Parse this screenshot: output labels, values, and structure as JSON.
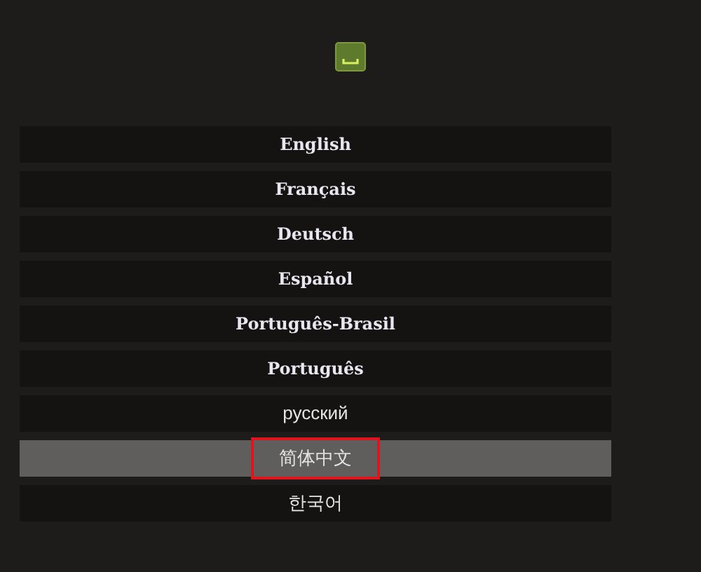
{
  "languages": [
    {
      "label": "English",
      "kind": "bold",
      "selected": false,
      "annotated": false
    },
    {
      "label": "Français",
      "kind": "bold",
      "selected": false,
      "annotated": false
    },
    {
      "label": "Deutsch",
      "kind": "bold",
      "selected": false,
      "annotated": false
    },
    {
      "label": "Español",
      "kind": "bold",
      "selected": false,
      "annotated": false
    },
    {
      "label": "Português-Brasil",
      "kind": "bold",
      "selected": false,
      "annotated": false
    },
    {
      "label": "Português",
      "kind": "bold",
      "selected": false,
      "annotated": false
    },
    {
      "label": "русский",
      "kind": "plain",
      "selected": false,
      "annotated": false
    },
    {
      "label": "简体中文",
      "kind": "plain",
      "selected": true,
      "annotated": true
    },
    {
      "label": "한국어",
      "kind": "plain",
      "selected": false,
      "annotated": false
    }
  ]
}
